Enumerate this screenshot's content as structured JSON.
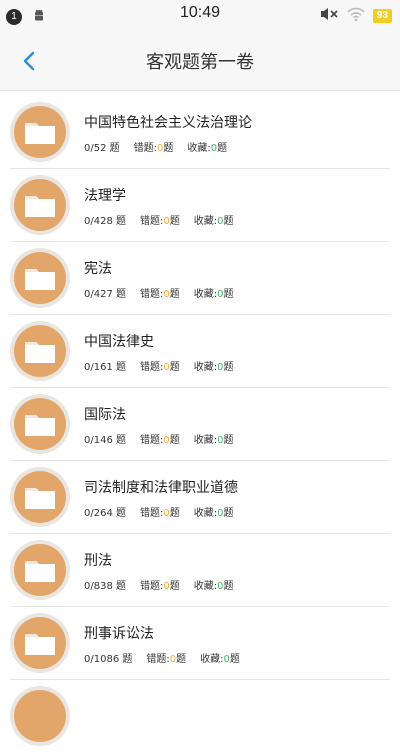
{
  "status_bar": {
    "notification_count": "1",
    "time": "10:49",
    "battery": "93",
    "icons": [
      "android-icon",
      "mute-icon",
      "wifi-icon",
      "battery-icon"
    ]
  },
  "navbar": {
    "title": "客观题第一卷",
    "back_icon": "chevron-left-icon"
  },
  "colors": {
    "accent": "#2a8fd6",
    "folder_bg": "#e2a56a",
    "wrong": "#f0b038",
    "favorite": "#4ab46a"
  },
  "wrong_label": "错题:",
  "fav_label": "收藏:",
  "unit_label": "题",
  "items": [
    {
      "title": "中国特色社会主义法治理论",
      "count": "0/52 题",
      "wrong": "0",
      "fav": "0"
    },
    {
      "title": "法理学",
      "count": "0/428 题",
      "wrong": "0",
      "fav": "0"
    },
    {
      "title": "宪法",
      "count": "0/427 题",
      "wrong": "0",
      "fav": "0"
    },
    {
      "title": "中国法律史",
      "count": "0/161 题",
      "wrong": "0",
      "fav": "0"
    },
    {
      "title": "国际法",
      "count": "0/146 题",
      "wrong": "0",
      "fav": "0"
    },
    {
      "title": "司法制度和法律职业道德",
      "count": "0/264 题",
      "wrong": "0",
      "fav": "0"
    },
    {
      "title": "刑法",
      "count": "0/838 题",
      "wrong": "0",
      "fav": "0"
    },
    {
      "title": "刑事诉讼法",
      "count": "0/1086 题",
      "wrong": "0",
      "fav": "0"
    }
  ]
}
